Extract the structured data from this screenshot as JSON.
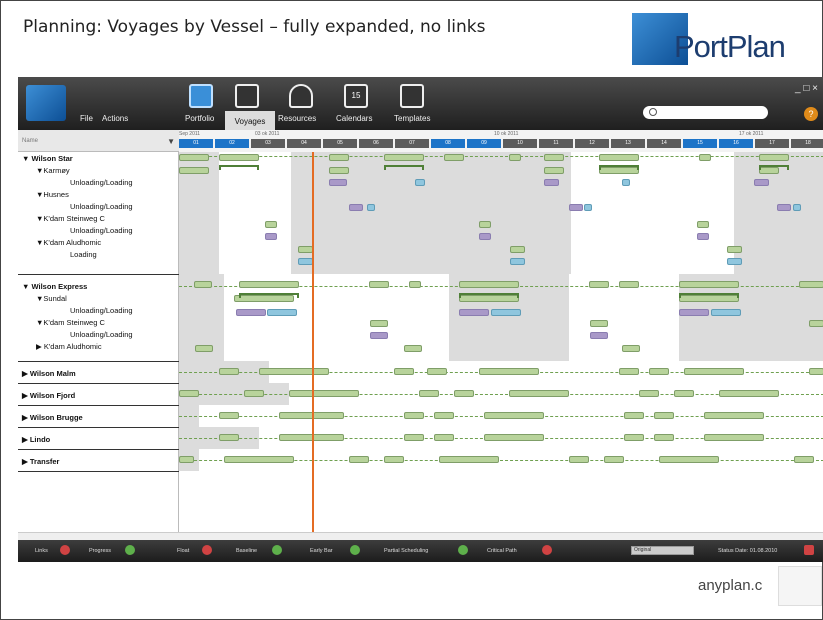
{
  "slide": {
    "title": "Planning: Voyages by Vessel – fully expanded, no links",
    "brand": "PortPlan",
    "footer": "anyplan.c"
  },
  "toolbar": {
    "file": "File",
    "actions": "Actions",
    "tabs": [
      {
        "label": "Portfolio",
        "icon": "portfolio-icon"
      },
      {
        "label": "Voyages",
        "icon": "voyages-icon"
      },
      {
        "label": "Resources",
        "icon": "resources-icon"
      },
      {
        "label": "Calendars",
        "icon": "calendar-icon",
        "badge": "15"
      },
      {
        "label": "Templates",
        "icon": "templates-icon"
      }
    ],
    "window_controls": "_ □ ×",
    "help": "?"
  },
  "tree": {
    "header": "Name",
    "rows": [
      {
        "label": "▼ Wilson Star",
        "level": 0,
        "group": true
      },
      {
        "label": "▼Karmøy",
        "level": 1
      },
      {
        "label": "Unloading/Loading",
        "level": 3
      },
      {
        "label": "▼Husnes",
        "level": 1
      },
      {
        "label": "Unloading/Loading",
        "level": 3
      },
      {
        "label": "▼K'dam Steinweg C",
        "level": 1
      },
      {
        "label": "Unloading/Loading",
        "level": 3
      },
      {
        "label": "▼K'dam Aludhomic",
        "level": 1
      },
      {
        "label": "Loading",
        "level": 3
      },
      {
        "label": "▼ Wilson Express",
        "level": 0,
        "group": true
      },
      {
        "label": "▼Sundal",
        "level": 1
      },
      {
        "label": "Unloading/Loading",
        "level": 3
      },
      {
        "label": "▼K'dam Steinweg C",
        "level": 1
      },
      {
        "label": "Unloading/Loading",
        "level": 3
      },
      {
        "label": "▶ K'dam Aludhomic",
        "level": 1
      },
      {
        "label": "▶ Wilson Malm",
        "level": 0,
        "group": true
      },
      {
        "label": "▶ Wilson Fjord",
        "level": 0,
        "group": true
      },
      {
        "label": "▶ Wilson Brugge",
        "level": 0,
        "group": true
      },
      {
        "label": "▶ Lindo",
        "level": 0,
        "group": true
      },
      {
        "label": "▶ Transfer",
        "level": 0,
        "group": true
      }
    ]
  },
  "timeline": {
    "dates": [
      "Sep 2011",
      "03 ok 2011",
      "10 ok 2011",
      "17 ok 2011"
    ],
    "cells": [
      "01",
      "02",
      "03",
      "04",
      "05",
      "06",
      "07",
      "08",
      "09",
      "10",
      "11",
      "12",
      "13",
      "14",
      "15",
      "16",
      "17",
      "18"
    ]
  },
  "status_bar": {
    "items": [
      {
        "label": "Links",
        "state": "off"
      },
      {
        "label": "Progress",
        "state": "on"
      },
      {
        "label": "Float",
        "state": "off"
      },
      {
        "label": "Baseline",
        "state": "on"
      },
      {
        "label": "Early Bar",
        "state": "on"
      },
      {
        "label": "Partial Scheduling",
        "state": "on"
      },
      {
        "label": "Critical Path",
        "state": "off"
      }
    ],
    "select": "Original",
    "status_date": "Status Date: 01.08.2010"
  },
  "colors": {
    "accent": "#1d74c8",
    "today_line": "#e46c24",
    "bar": "#b8d39b"
  }
}
